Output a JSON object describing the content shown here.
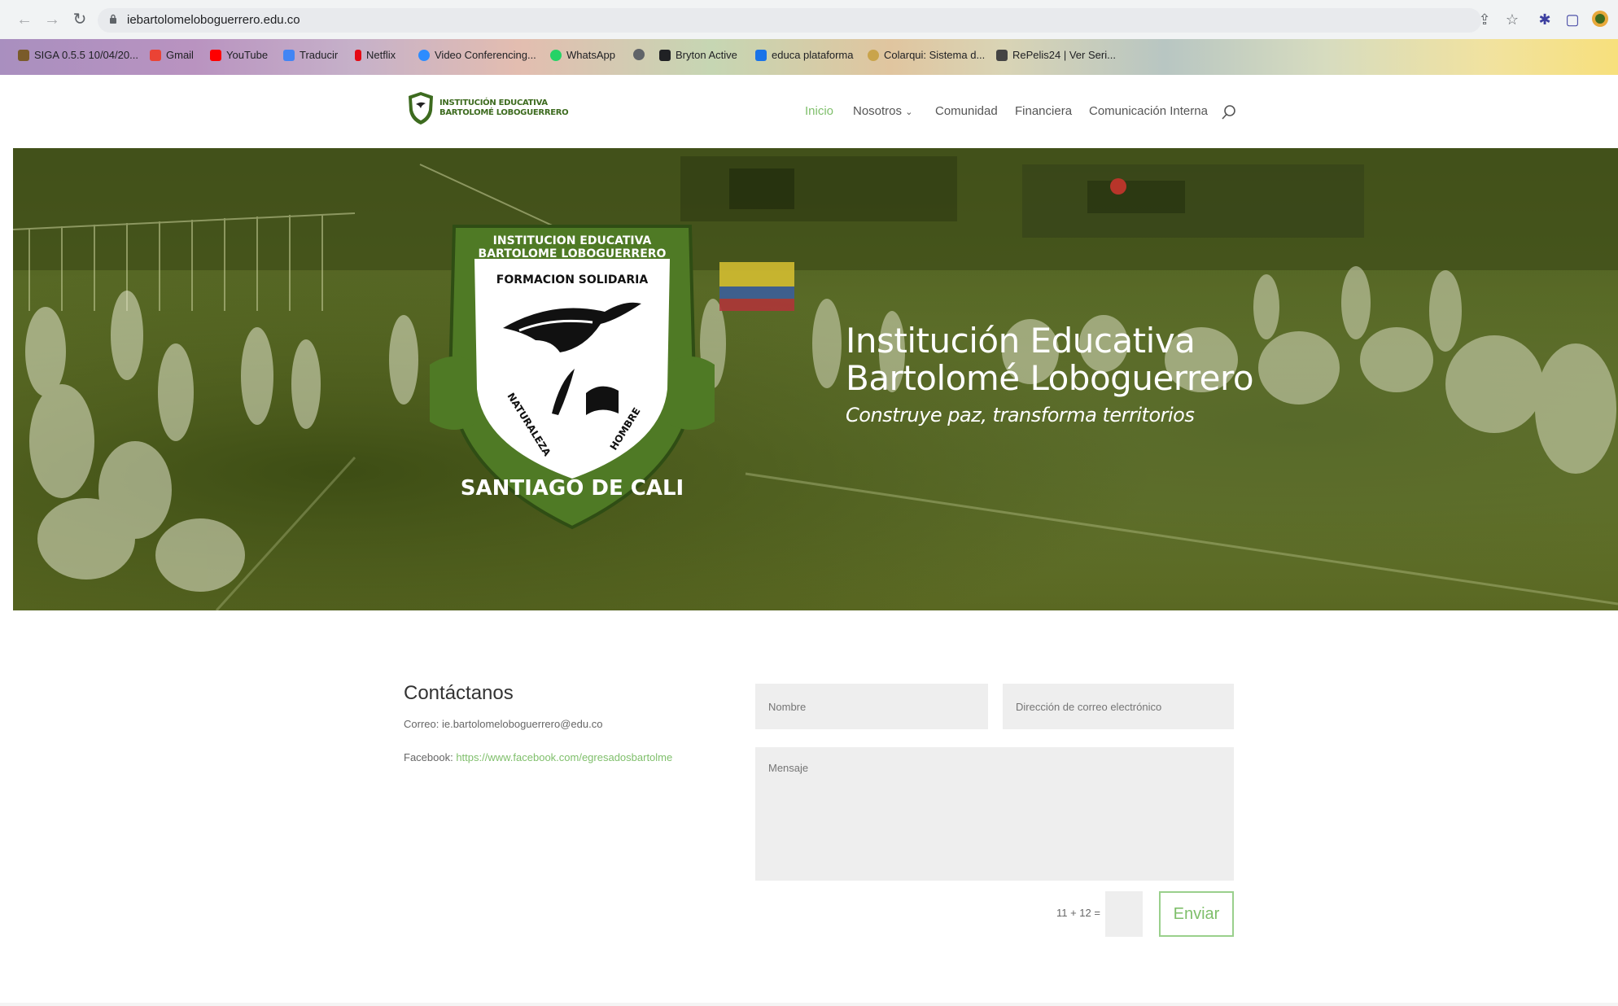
{
  "browser": {
    "url": "iebartolomeloboguerrero.edu.co",
    "bookmarks": [
      "SIGA 0.5.5 10/04/20...",
      "Gmail",
      "YouTube",
      "Traducir",
      "Netflix",
      "Video Conferencing...",
      "WhatsApp",
      "",
      "Bryton Active",
      "educa plataforma",
      "Colarqui: Sistema d...",
      "RePelis24 | Ver Seri..."
    ]
  },
  "site": {
    "logo_line1": "INSTITUCIÓN EDUCATIVA",
    "logo_line2": "BARTOLOMÉ LOBOGUERRERO",
    "menu": {
      "inicio": "Inicio",
      "nosotros": "Nosotros",
      "comunidad": "Comunidad",
      "financiera": "Financiera",
      "comunicacion": "Comunicación Interna"
    }
  },
  "hero": {
    "title_line1": "Institución Educativa",
    "title_line2": "Bartolomé Loboguerrero",
    "subtitle": "Construye paz, transforma territorios",
    "emblem": {
      "top1": "INSTITUCION EDUCATIVA",
      "top2": "BARTOLOME LOBOGUERRERO",
      "banner": "FORMACION SOLIDARIA",
      "left": "NATURALEZA",
      "right": "HOMBRE",
      "bottom": "SANTIAGO DE CALI"
    }
  },
  "contact": {
    "title": "Contáctanos",
    "email_line": "Correo: ie.bartolomeloboguerrero@edu.co",
    "facebook_label": "Facebook:",
    "facebook_url": "https://www.facebook.com/egresadosbartolme",
    "name_placeholder": "Nombre",
    "email_placeholder": "Dirección de correo electrónico",
    "message_placeholder": "Mensaje",
    "captcha": "11 + 12 =",
    "submit": "Enviar"
  },
  "colors": {
    "accent": "#7fbf6b",
    "hero_tint": "#5a6b26",
    "emblem_green": "#4f7a25"
  }
}
